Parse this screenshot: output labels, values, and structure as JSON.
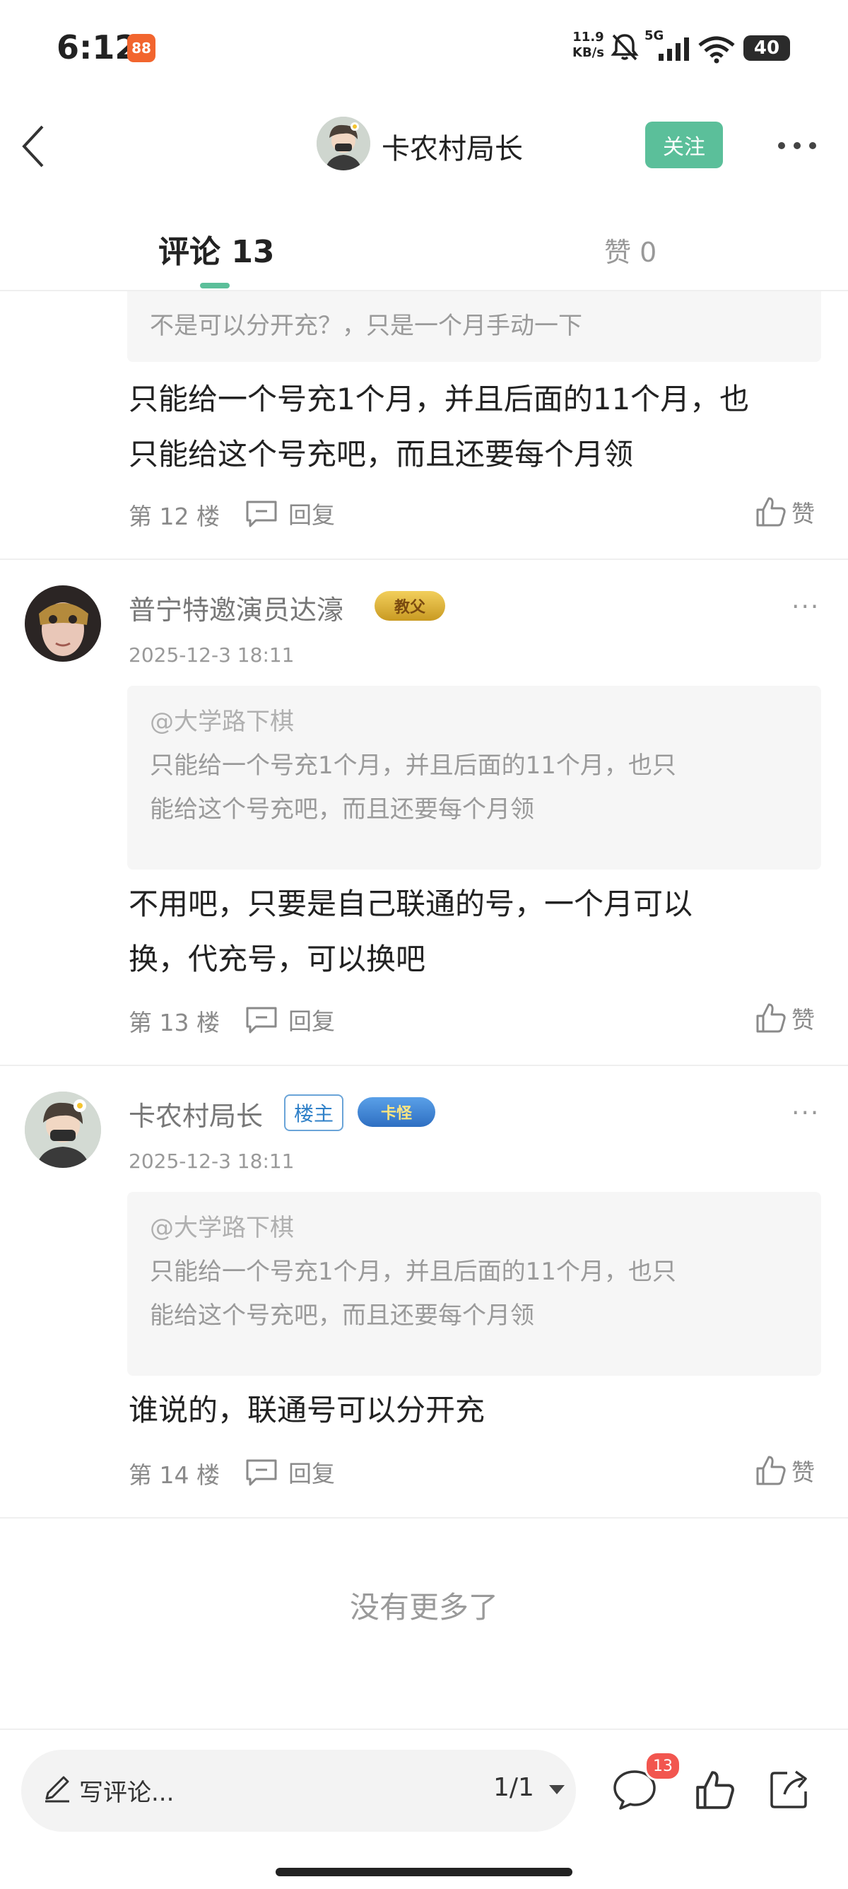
{
  "status_bar": {
    "time": "6:12",
    "app_icon_text": "88",
    "net_speed_value": "11.9",
    "net_speed_unit": "KB/s",
    "signal_label": "5G",
    "battery": "40"
  },
  "header": {
    "title": "卡农村局长",
    "follow_label": "关注"
  },
  "tabs": {
    "comments": "评论 13",
    "likes": "赞 0"
  },
  "comments": [
    {
      "quote_lines": [
        "不是可以分开充？，只是一个月手动一下"
      ],
      "text_lines": [
        "只能给一个号充1个月，并且后面的11个月，也",
        "只能给这个号充吧，而且还要每个月领"
      ],
      "floor": "第 12 楼",
      "reply_label": "回复",
      "like_label": "赞"
    },
    {
      "username": "普宁特邀演员达濠",
      "medal": "教父",
      "timestamp": "2025-12-3 18:11",
      "quote_author": "@大学路下棋",
      "quote_lines": [
        "只能给一个号充1个月，并且后面的11个月，也只",
        "能给这个号充吧，而且还要每个月领"
      ],
      "text_lines": [
        "不用吧，只要是自己联通的号，一个月可以",
        "换，代充号，可以换吧"
      ],
      "floor": "第 13 楼",
      "reply_label": "回复",
      "like_label": "赞"
    },
    {
      "username": "卡农村局长",
      "op_badge": "楼主",
      "medal": "卡怪",
      "timestamp": "2025-12-3 18:11",
      "quote_author": "@大学路下棋",
      "quote_lines": [
        "只能给一个号充1个月，并且后面的11个月，也只",
        "能给这个号充吧，而且还要每个月领"
      ],
      "text_lines": [
        "谁说的，联通号可以分开充"
      ],
      "floor": "第 14 楼",
      "reply_label": "回复",
      "like_label": "赞"
    }
  ],
  "footer_note": "没有更多了",
  "bottom_bar": {
    "write_placeholder": "写评论...",
    "pager": "1/1",
    "comment_count": "13"
  },
  "colors": {
    "accent": "#5bbf9a",
    "badge_red": "#f2564f",
    "op_badge_blue": "#2f80c8"
  }
}
